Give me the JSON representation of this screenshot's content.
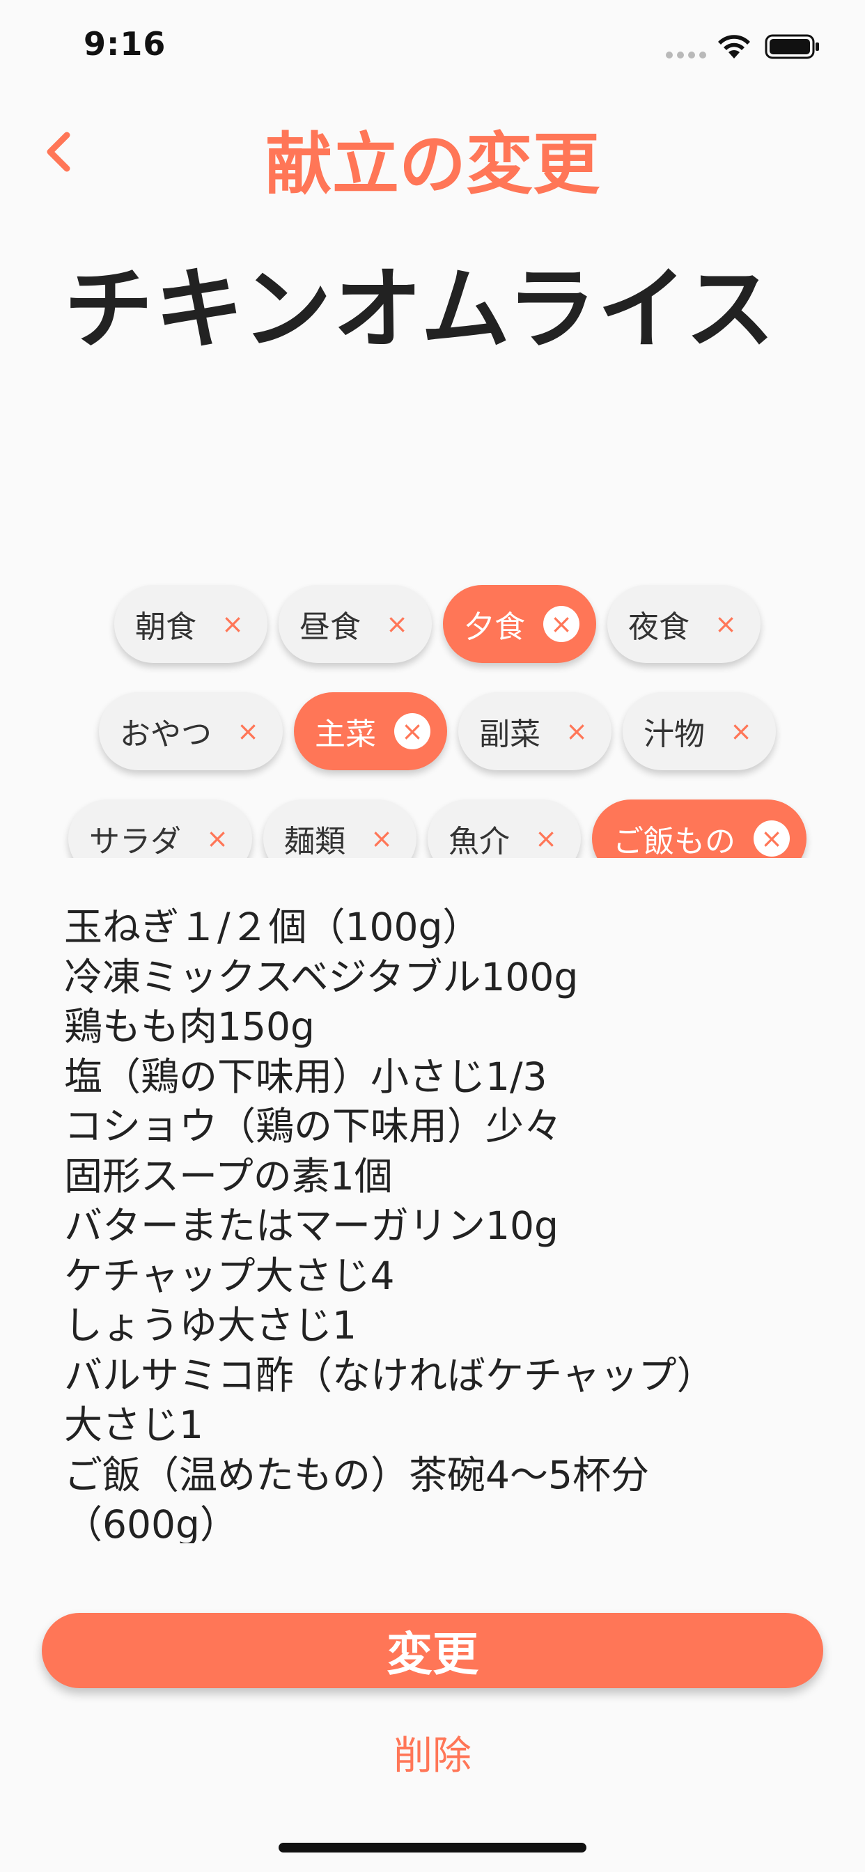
{
  "status_bar": {
    "time": "9:16"
  },
  "nav": {
    "back_icon": "chevron-left-icon",
    "title": "献立の変更"
  },
  "recipe": {
    "name": "チキンオムライス"
  },
  "colors": {
    "accent": "#FF7657",
    "tag_background": "#F2F2F2",
    "text": "#222222"
  },
  "tags": {
    "rows": [
      [
        {
          "label": "朝食",
          "selected": false
        },
        {
          "label": "昼食",
          "selected": false
        },
        {
          "label": "夕食",
          "selected": true
        },
        {
          "label": "夜食",
          "selected": false
        }
      ],
      [
        {
          "label": "おやつ",
          "selected": false
        },
        {
          "label": "主菜",
          "selected": true
        },
        {
          "label": "副菜",
          "selected": false
        },
        {
          "label": "汁物",
          "selected": false
        }
      ],
      [
        {
          "label": "サラダ",
          "selected": false
        },
        {
          "label": "麺類",
          "selected": false
        },
        {
          "label": "魚介",
          "selected": false
        },
        {
          "label": "ご飯もの",
          "selected": true
        }
      ]
    ],
    "remove_symbol": "×"
  },
  "ingredients": [
    "玉ねぎ１/２個（100g）",
    "冷凍ミックスベジタブル100g",
    "鶏もも肉150g",
    "塩（鶏の下味用）小さじ1/3",
    "コショウ（鶏の下味用）少々",
    "固形スープの素1個",
    "バターまたはマーガリン10g",
    "ケチャップ大さじ4",
    "しょうゆ大さじ1",
    "バルサミコ酢（なければケチャップ）",
    "大さじ1",
    "ご飯（温めたもの）茶碗4〜5杯分",
    "（600g）"
  ],
  "actions": {
    "submit_label": "変更",
    "delete_label": "削除"
  }
}
